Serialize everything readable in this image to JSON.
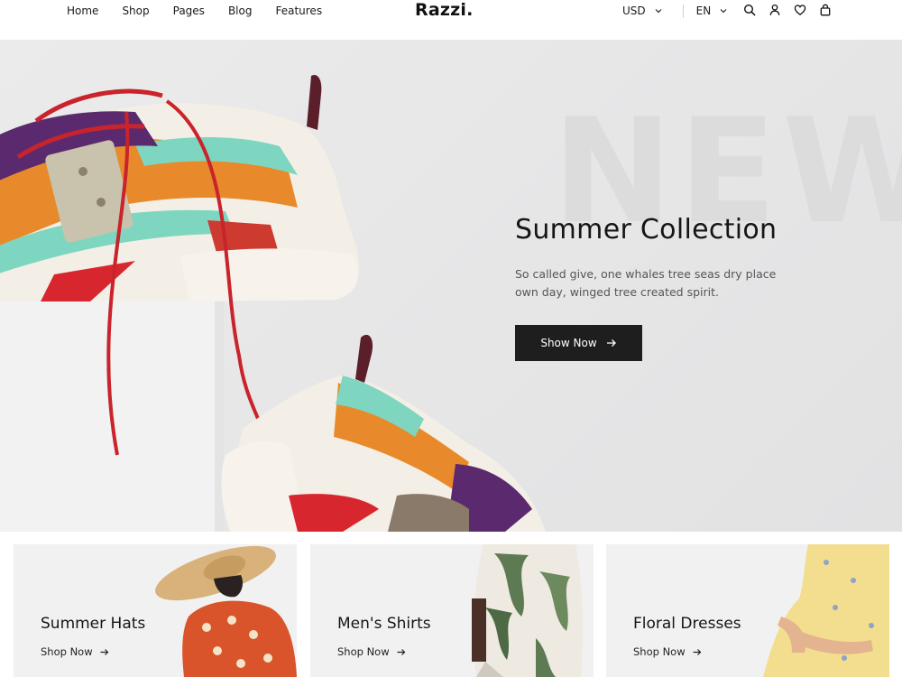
{
  "header": {
    "nav": [
      "Home",
      "Shop",
      "Pages",
      "Blog",
      "Features"
    ],
    "logo": "Razzi.",
    "currency": "USD",
    "language": "EN",
    "icons": [
      "search-icon",
      "account-icon",
      "wishlist-icon",
      "cart-icon"
    ]
  },
  "hero": {
    "watermark": "NEW",
    "title": "Summer Collection",
    "description": "So called give, one whales tree seas dry place own day, winged tree created spirit.",
    "button_label": "Show Now"
  },
  "categories": [
    {
      "title": "Summer Hats",
      "link": "Shop Now"
    },
    {
      "title": "Men's Shirts",
      "link": "Shop Now"
    },
    {
      "title": "Floral Dresses",
      "link": "Shop Now"
    }
  ],
  "colors": {
    "primary": "#1e1e1e",
    "hero_bg": "#e7e7e8",
    "card_bg": "#f1f1f1",
    "text_muted": "#555555"
  }
}
